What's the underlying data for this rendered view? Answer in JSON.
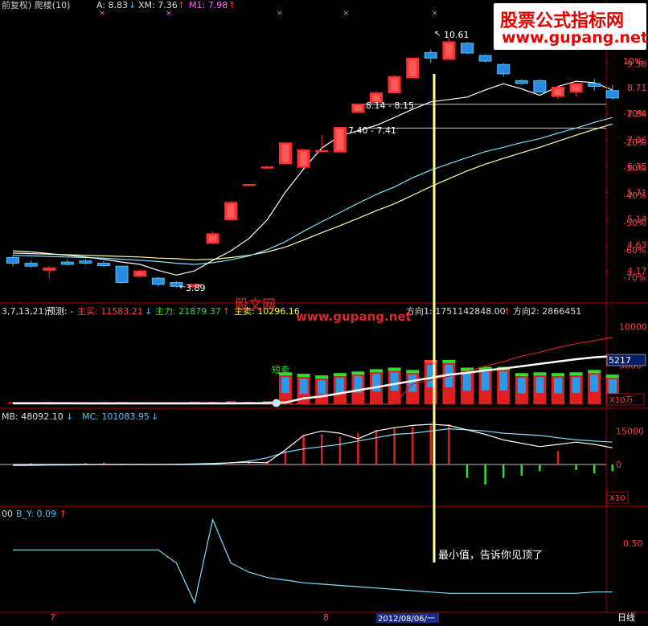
{
  "header": {
    "title": "前复权) 爬楼(10)",
    "a_label": "A: 8.83",
    "xm_label": "XM: 7.36",
    "m1_label": "M1: 7.98"
  },
  "watermark": {
    "line1": "股票公式指标网",
    "line2": "www.gupang.net",
    "overlay_url": "www.gupang.net",
    "overlay_cn": "股文网"
  },
  "chart_data": [
    {
      "type": "candlestick",
      "panel": "price",
      "candles": [
        {
          "o": 4.4,
          "c": 4.3,
          "h": 4.44,
          "l": 4.25
        },
        {
          "o": 4.3,
          "c": 4.25,
          "h": 4.34,
          "l": 4.22
        },
        {
          "o": 4.18,
          "c": 4.22,
          "h": 4.25,
          "l": 4.05
        },
        {
          "o": 4.32,
          "c": 4.28,
          "h": 4.36,
          "l": 4.26
        },
        {
          "o": 4.34,
          "c": 4.3,
          "h": 4.37,
          "l": 4.28
        },
        {
          "o": 4.3,
          "c": 4.26,
          "h": 4.34,
          "l": 4.24
        },
        {
          "o": 4.25,
          "c": 3.98,
          "h": 4.26,
          "l": 3.96
        },
        {
          "o": 4.08,
          "c": 4.17,
          "h": 4.19,
          "l": 4.06
        },
        {
          "o": 4.05,
          "c": 3.95,
          "h": 4.07,
          "l": 3.92
        },
        {
          "o": 3.98,
          "c": 3.92,
          "h": 4.0,
          "l": 3.9
        },
        {
          "o": 3.91,
          "c": 3.95,
          "h": 3.96,
          "l": 3.88
        },
        {
          "o": 4.66,
          "c": 4.84,
          "h": 4.88,
          "l": 4.64
        },
        {
          "o": 5.12,
          "c": 5.49,
          "h": 5.52,
          "l": 5.1
        },
        {
          "o": 5.9,
          "c": 5.9,
          "h": 5.9,
          "l": 5.9
        },
        {
          "o": 6.3,
          "c": 6.33,
          "h": 6.36,
          "l": 6.28
        },
        {
          "o": 6.41,
          "c": 6.97,
          "h": 7.0,
          "l": 6.4
        },
        {
          "o": 6.32,
          "c": 6.78,
          "h": 6.8,
          "l": 6.3
        },
        {
          "o": 6.76,
          "c": 6.76,
          "h": 7.2,
          "l": 6.7
        },
        {
          "o": 6.72,
          "c": 7.42,
          "h": 7.43,
          "l": 6.7
        },
        {
          "o": 7.88,
          "c": 8.15,
          "h": 8.16,
          "l": 7.86
        },
        {
          "o": 8.2,
          "c": 8.52,
          "h": 8.6,
          "l": 8.18
        },
        {
          "o": 8.52,
          "c": 9.1,
          "h": 9.15,
          "l": 8.5
        },
        {
          "o": 9.05,
          "c": 9.8,
          "h": 9.82,
          "l": 9.03
        },
        {
          "o": 10.02,
          "c": 9.8,
          "h": 10.15,
          "l": 9.6
        },
        {
          "o": 9.75,
          "c": 10.46,
          "h": 10.61,
          "l": 9.72
        },
        {
          "o": 10.4,
          "c": 10.0,
          "h": 10.45,
          "l": 9.95
        },
        {
          "o": 9.9,
          "c": 9.68,
          "h": 9.95,
          "l": 9.62
        },
        {
          "o": 9.55,
          "c": 9.2,
          "h": 9.6,
          "l": 9.1
        },
        {
          "o": 8.95,
          "c": 8.85,
          "h": 9.0,
          "l": 8.8
        },
        {
          "o": 8.95,
          "c": 8.55,
          "h": 9.0,
          "l": 8.5
        },
        {
          "o": 8.4,
          "c": 8.72,
          "h": 8.76,
          "l": 8.3
        },
        {
          "o": 8.55,
          "c": 8.85,
          "h": 8.88,
          "l": 8.4
        },
        {
          "o": 8.85,
          "c": 8.75,
          "h": 9.0,
          "l": 8.6
        },
        {
          "o": 8.6,
          "c": 8.35,
          "h": 8.8,
          "l": 8.3
        }
      ],
      "xm_line": [
        4.52,
        4.5,
        4.47,
        4.44,
        4.41,
        4.37,
        4.32,
        4.28,
        4.18,
        4.1,
        4.17,
        4.35,
        4.52,
        4.75,
        5.12,
        5.72,
        6.28,
        6.83,
        7.17,
        7.32,
        7.48,
        7.72,
        7.98,
        8.22,
        8.3,
        8.38,
        8.62,
        8.84,
        8.66,
        8.44,
        8.74,
        8.93,
        8.88,
        8.62
      ],
      "ma_cyan": [
        4.44,
        4.43,
        4.42,
        4.41,
        4.4,
        4.39,
        4.37,
        4.35,
        4.33,
        4.3,
        4.28,
        4.31,
        4.36,
        4.43,
        4.54,
        4.69,
        4.89,
        5.08,
        5.27,
        5.47,
        5.67,
        5.84,
        6.06,
        6.25,
        6.41,
        6.57,
        6.73,
        6.85,
        6.98,
        7.09,
        7.25,
        7.4,
        7.57,
        7.72
      ],
      "ma_yellow": [
        4.48,
        4.47,
        4.46,
        4.45,
        4.44,
        4.43,
        4.42,
        4.41,
        4.39,
        4.38,
        4.36,
        4.37,
        4.4,
        4.44,
        4.5,
        4.59,
        4.72,
        4.86,
        5.0,
        5.15,
        5.31,
        5.46,
        5.65,
        5.85,
        6.04,
        6.23,
        6.4,
        6.55,
        6.7,
        6.85,
        7.02,
        7.19,
        7.36,
        7.52
      ],
      "y_ticks": [
        {
          "v": 9.58,
          "label": "9.58"
        },
        {
          "v": 8.71,
          "label": "8.71"
        },
        {
          "v": 7.84,
          "label": "7.84"
        },
        {
          "v": 7.06,
          "label": "7.06"
        },
        {
          "v": 6.35,
          "label": "6.35"
        },
        {
          "v": 5.71,
          "label": "5.71"
        },
        {
          "v": 5.14,
          "label": "5.14"
        },
        {
          "v": 4.63,
          "label": "4.63"
        },
        {
          "v": 4.17,
          "label": "4.17"
        }
      ],
      "pct_ticks": [
        {
          "label": "10%"
        },
        {
          "label": "-10%"
        },
        {
          "label": "-20%"
        },
        {
          "label": "-30%"
        },
        {
          "label": "-40%"
        },
        {
          "label": "-50%"
        },
        {
          "label": "-60%"
        },
        {
          "label": "-70%"
        }
      ],
      "annotations": {
        "high": "10.61",
        "low": "3.89",
        "range1": "8.14 - 8.15",
        "range2": "7.40 - 7.41"
      },
      "levels": [
        8.14,
        7.4
      ]
    },
    {
      "type": "bar",
      "panel": "volume",
      "header": {
        "params": "3,7,13,21)",
        "forecast": "预测: -",
        "buy": "主买: 11583.21",
        "main": "主力: 21879.37",
        "sell": "主卖: 10296.16",
        "dir1": "方向1: 1751142848.00",
        "dir2": "方向2: 2866451"
      },
      "values": [
        60,
        70,
        80,
        60,
        50,
        60,
        80,
        50,
        50,
        40,
        120,
        100,
        200,
        100,
        200,
        3700,
        3500,
        3300,
        3600,
        3800,
        4100,
        4300,
        4000,
        5300,
        5300,
        4300,
        4400,
        4400,
        3600,
        3700,
        3600,
        3700,
        4000,
        3400
      ],
      "white_line": [
        120,
        120,
        120,
        120,
        115,
        115,
        115,
        115,
        110,
        110,
        110,
        110,
        110,
        120,
        140,
        220,
        760,
        1000,
        1400,
        1800,
        2200,
        2600,
        3000,
        3400,
        3800,
        4050,
        4350,
        4600,
        4900,
        5200,
        5500,
        5800,
        6050,
        6200
      ],
      "red_line": [
        0,
        0,
        0,
        0,
        0,
        0,
        0,
        0,
        0,
        0,
        0,
        0,
        0,
        0,
        0,
        0,
        0,
        0,
        0,
        0,
        0,
        0,
        2600,
        3100,
        3600,
        4200,
        4900,
        5500,
        6200,
        6700,
        7300,
        7800,
        8200,
        8600
      ],
      "y_ticks": [
        "10000",
        "5000"
      ],
      "value_box": "5217",
      "unit_box": "X10万",
      "label": "短卖"
    },
    {
      "type": "bar",
      "panel": "mb",
      "header": {
        "mb": "MB: 48092.10",
        "mc": "MC: 101083.95"
      },
      "values": [
        200,
        600,
        300,
        100,
        800,
        900,
        400,
        400,
        200,
        100,
        -200,
        300,
        900,
        1200,
        1500,
        6000,
        13000,
        13500,
        12500,
        14000,
        15500,
        16500,
        17000,
        17500,
        18000,
        -6000,
        -9000,
        -6000,
        -5000,
        -3000,
        6000,
        -2500,
        -4000,
        -3000
      ],
      "white_line": [
        0,
        0,
        0,
        0,
        0,
        0,
        0,
        0,
        0,
        0,
        0,
        200,
        800,
        1000,
        800,
        6500,
        13000,
        15000,
        14000,
        11500,
        15000,
        16500,
        17500,
        18000,
        17500,
        15500,
        13500,
        11000,
        9500,
        8000,
        9000,
        10000,
        9000,
        7500
      ],
      "cyan_line": [
        -500,
        -400,
        -300,
        -200,
        -100,
        0,
        0,
        0,
        0,
        100,
        300,
        500,
        800,
        1500,
        3000,
        5500,
        7000,
        8000,
        9000,
        10500,
        12000,
        13500,
        14000,
        15000,
        16000,
        15500,
        15000,
        14000,
        13500,
        13000,
        12000,
        11000,
        10500,
        10000
      ],
      "y_ticks": [
        "15000",
        "0"
      ],
      "unit_box": "X10"
    },
    {
      "type": "line",
      "panel": "by",
      "header": {
        "prefix": "00",
        "by": "B_Y: 0.09"
      },
      "values": [
        0.45,
        0.45,
        0.45,
        0.45,
        0.45,
        0.45,
        0.45,
        0.45,
        0.45,
        0.35,
        0.05,
        0.68,
        0.35,
        0.28,
        0.24,
        0.22,
        0.2,
        0.19,
        0.18,
        0.17,
        0.16,
        0.15,
        0.14,
        0.13,
        0.12,
        0.12,
        0.12,
        0.12,
        0.12,
        0.12,
        0.12,
        0.12,
        0.13,
        0.13
      ],
      "y_ticks": [
        "0.50"
      ],
      "note": "最小值，告诉你见顶了"
    }
  ],
  "xaxis": {
    "label7": "7",
    "label8": "8",
    "date": "2012/08/06/一",
    "mode": "日线"
  }
}
